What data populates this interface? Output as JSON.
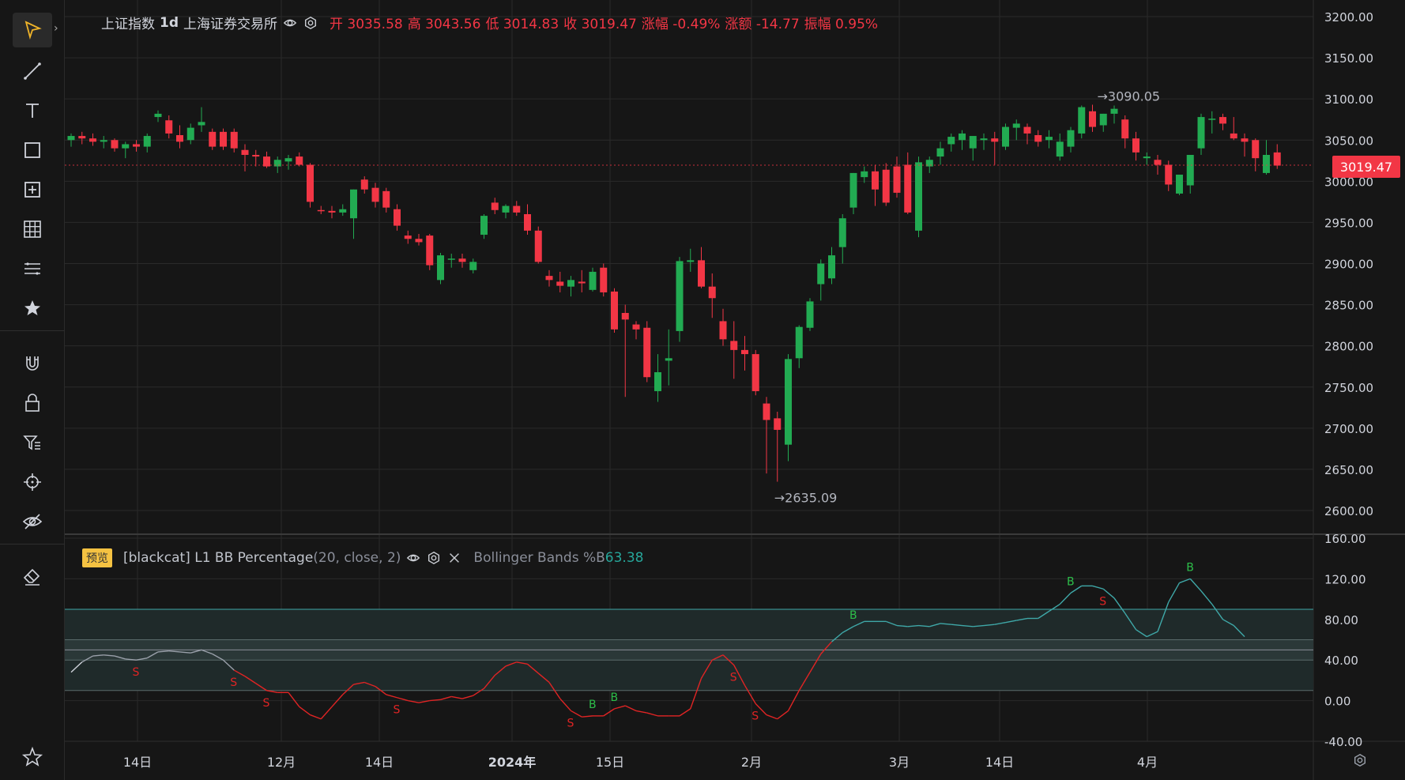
{
  "toolbar": {
    "tooltip": "光标",
    "tools": [
      {
        "name": "cursor-tool-icon",
        "active": true
      },
      {
        "name": "trend-line-tool-icon"
      },
      {
        "name": "text-tool-icon"
      },
      {
        "name": "rectangle-tool-icon"
      },
      {
        "name": "measure-tool-icon"
      },
      {
        "name": "grid-tool-icon"
      },
      {
        "name": "fib-tool-icon"
      },
      {
        "name": "favorite-star-icon"
      },
      {
        "name": "magnet-icon"
      },
      {
        "name": "lock-icon"
      },
      {
        "name": "filter-icon"
      },
      {
        "name": "crosshair-icon"
      },
      {
        "name": "hide-eye-icon"
      },
      {
        "name": "eraser-icon"
      },
      {
        "name": "star-outline-icon"
      }
    ]
  },
  "legend": {
    "symbol": "上证指数",
    "interval": "1d",
    "exchange": "上海证券交易所",
    "open_label": "开",
    "open": "3035.58",
    "high_label": "高",
    "high": "3043.56",
    "low_label": "低",
    "low": "3014.83",
    "close_label": "收",
    "close": "3019.47",
    "change_pct_label": "涨幅",
    "change_pct": "-0.49%",
    "change_label": "涨额",
    "change": "-14.77",
    "amplitude_label": "振幅",
    "amplitude": "0.95%"
  },
  "indicator": {
    "badge": "预览",
    "name": "[blackcat] L1 BB Percentage",
    "params": "(20, close, 2)",
    "series_label": "Bollinger Bands %B",
    "value": "63.38"
  },
  "colors": {
    "up": "#089981",
    "up_fill": "#22ab52",
    "down": "#f23645",
    "line_red": "#e02424",
    "line_teal": "#3fa8a8",
    "bg": "#161616",
    "grid": "#2a2a2a"
  },
  "chart_data": [
    {
      "type": "candlestick",
      "ylim": [
        2580,
        3220
      ],
      "y_ticks": [
        "3200.00",
        "3150.00",
        "3100.00",
        "3050.00",
        "3000.00",
        "2950.00",
        "2900.00",
        "2850.00",
        "2800.00",
        "2750.00",
        "2700.00",
        "2650.00",
        "2600.00"
      ],
      "x_ticks": [
        "14日",
        "12月",
        "14日",
        "2024年",
        "15日",
        "2月",
        "3月",
        "14日",
        "4月"
      ],
      "last_price_label": "3019.47",
      "annotations": [
        "→3090.05",
        "→2635.09"
      ],
      "ohlc": [
        [
          3050,
          3058,
          3042,
          3055
        ],
        [
          3055,
          3060,
          3045,
          3052
        ],
        [
          3052,
          3058,
          3043,
          3048
        ],
        [
          3048,
          3055,
          3040,
          3050
        ],
        [
          3050,
          3052,
          3036,
          3040
        ],
        [
          3040,
          3048,
          3028,
          3045
        ],
        [
          3045,
          3050,
          3036,
          3042
        ],
        [
          3042,
          3058,
          3035,
          3055
        ],
        [
          3078,
          3086,
          3072,
          3082
        ],
        [
          3074,
          3080,
          3052,
          3058
        ],
        [
          3056,
          3068,
          3040,
          3048
        ],
        [
          3050,
          3070,
          3045,
          3065
        ],
        [
          3068,
          3090,
          3060,
          3072
        ],
        [
          3060,
          3064,
          3038,
          3042
        ],
        [
          3060,
          3064,
          3038,
          3042
        ],
        [
          3060,
          3064,
          3035,
          3040
        ],
        [
          3038,
          3045,
          3012,
          3032
        ],
        [
          3032,
          3038,
          3018,
          3030
        ],
        [
          3030,
          3036,
          3016,
          3018
        ],
        [
          3018,
          3030,
          3010,
          3026
        ],
        [
          3024,
          3032,
          3014,
          3028
        ],
        [
          3030,
          3035,
          3018,
          3020
        ],
        [
          3020,
          3022,
          2968,
          2975
        ],
        [
          2965,
          2970,
          2960,
          2964
        ],
        [
          2964,
          2970,
          2955,
          2962
        ],
        [
          2962,
          2972,
          2958,
          2966
        ],
        [
          2955,
          2990,
          2930,
          2990
        ],
        [
          3002,
          3006,
          2985,
          2990
        ],
        [
          2992,
          2998,
          2968,
          2975
        ],
        [
          2988,
          2992,
          2962,
          2968
        ],
        [
          2966,
          2972,
          2940,
          2946
        ],
        [
          2934,
          2940,
          2924,
          2930
        ],
        [
          2930,
          2936,
          2922,
          2926
        ],
        [
          2934,
          2936,
          2892,
          2898
        ],
        [
          2880,
          2913,
          2875,
          2910
        ],
        [
          2905,
          2912,
          2895,
          2906
        ],
        [
          2906,
          2912,
          2895,
          2902
        ],
        [
          2892,
          2906,
          2888,
          2902
        ],
        [
          2935,
          2960,
          2930,
          2958
        ],
        [
          2974,
          2980,
          2960,
          2965
        ],
        [
          2962,
          2972,
          2955,
          2970
        ],
        [
          2970,
          2976,
          2958,
          2962
        ],
        [
          2960,
          2972,
          2935,
          2940
        ],
        [
          2940,
          2945,
          2900,
          2902
        ],
        [
          2885,
          2892,
          2872,
          2880
        ],
        [
          2878,
          2890,
          2865,
          2873
        ],
        [
          2872,
          2885,
          2860,
          2880
        ],
        [
          2878,
          2892,
          2865,
          2876
        ],
        [
          2868,
          2895,
          2866,
          2890
        ],
        [
          2895,
          2900,
          2860,
          2865
        ],
        [
          2866,
          2870,
          2816,
          2820
        ],
        [
          2840,
          2850,
          2738,
          2832
        ],
        [
          2826,
          2830,
          2808,
          2820
        ],
        [
          2822,
          2830,
          2756,
          2762
        ],
        [
          2745,
          2790,
          2732,
          2768
        ],
        [
          2782,
          2820,
          2752,
          2785
        ],
        [
          2818,
          2908,
          2805,
          2903
        ],
        [
          2902,
          2918,
          2890,
          2904
        ],
        [
          2904,
          2920,
          2870,
          2872
        ],
        [
          2872,
          2888,
          2834,
          2858
        ],
        [
          2830,
          2845,
          2800,
          2808
        ],
        [
          2806,
          2830,
          2760,
          2795
        ],
        [
          2795,
          2812,
          2770,
          2790
        ],
        [
          2790,
          2795,
          2740,
          2745
        ],
        [
          2730,
          2738,
          2645,
          2710
        ],
        [
          2712,
          2720,
          2635,
          2698
        ],
        [
          2680,
          2790,
          2660,
          2784
        ],
        [
          2785,
          2825,
          2773,
          2823
        ],
        [
          2822,
          2858,
          2818,
          2854
        ],
        [
          2875,
          2905,
          2855,
          2900
        ],
        [
          2882,
          2920,
          2875,
          2910
        ],
        [
          2920,
          2960,
          2900,
          2955
        ],
        [
          2968,
          3010,
          2960,
          3010
        ],
        [
          3005,
          3018,
          2998,
          3012
        ],
        [
          3012,
          3020,
          2970,
          2990
        ],
        [
          3014,
          3022,
          2970,
          2974
        ],
        [
          3018,
          3030,
          2980,
          2986
        ],
        [
          3020,
          3035,
          2960,
          2962
        ],
        [
          2940,
          3030,
          2932,
          3023
        ],
        [
          3018,
          3030,
          3010,
          3026
        ],
        [
          3030,
          3048,
          3020,
          3040
        ],
        [
          3045,
          3058,
          3036,
          3054
        ],
        [
          3050,
          3062,
          3038,
          3058
        ],
        [
          3040,
          3052,
          3025,
          3055
        ],
        [
          3050,
          3058,
          3038,
          3052
        ],
        [
          3052,
          3060,
          3020,
          3048
        ],
        [
          3042,
          3070,
          3038,
          3066
        ],
        [
          3065,
          3075,
          3050,
          3070
        ],
        [
          3066,
          3070,
          3045,
          3058
        ],
        [
          3056,
          3062,
          3042,
          3048
        ],
        [
          3050,
          3062,
          3040,
          3054
        ],
        [
          3030,
          3058,
          3025,
          3048
        ],
        [
          3042,
          3066,
          3035,
          3062
        ],
        [
          3058,
          3092,
          3052,
          3090
        ],
        [
          3085,
          3093,
          3060,
          3066
        ],
        [
          3068,
          3082,
          3060,
          3082
        ],
        [
          3082,
          3092,
          3070,
          3088
        ],
        [
          3075,
          3080,
          3040,
          3052
        ],
        [
          3052,
          3060,
          3025,
          3035
        ],
        [
          3028,
          3035,
          3020,
          3030
        ],
        [
          3026,
          3032,
          3008,
          3020
        ],
        [
          3020,
          3025,
          2988,
          2996
        ],
        [
          2985,
          3000,
          2983,
          3008
        ],
        [
          2995,
          3032,
          2985,
          3032
        ],
        [
          3040,
          3082,
          3032,
          3078
        ],
        [
          3075,
          3085,
          3058,
          3076
        ],
        [
          3078,
          3082,
          3062,
          3070
        ],
        [
          3058,
          3078,
          3050,
          3052
        ],
        [
          3052,
          3058,
          3030,
          3048
        ],
        [
          3050,
          3052,
          3012,
          3028
        ],
        [
          3010,
          3050,
          3008,
          3032
        ],
        [
          3035,
          3045,
          3015,
          3019
        ]
      ]
    },
    {
      "type": "line",
      "title": "[blackcat] L1 BB Percentage",
      "ylim": [
        -40,
        160
      ],
      "y_ticks": [
        "160.00",
        "120.00",
        "80.00",
        "40.00",
        "0.00",
        "-40.00"
      ],
      "band_levels": [
        90,
        60,
        50,
        40,
        10
      ],
      "signals": [
        {
          "label": "S",
          "i": 6
        },
        {
          "label": "S",
          "i": 15
        },
        {
          "label": "S",
          "i": 18
        },
        {
          "label": "S",
          "i": 30
        },
        {
          "label": "S",
          "i": 46
        },
        {
          "label": "B",
          "i": 48
        },
        {
          "label": "B",
          "i": 50
        },
        {
          "label": "S",
          "i": 61
        },
        {
          "label": "S",
          "i": 63
        },
        {
          "label": "B",
          "i": 72
        },
        {
          "label": "B",
          "i": 92
        },
        {
          "label": "S",
          "i": 95
        },
        {
          "label": "B",
          "i": 103
        }
      ],
      "values": [
        28,
        38,
        44,
        45,
        44,
        41,
        40,
        42,
        48,
        49,
        48,
        47,
        50,
        46,
        40,
        30,
        24,
        17,
        10,
        8,
        8,
        -6,
        -14,
        -18,
        -6,
        6,
        16,
        18,
        14,
        6,
        3,
        0,
        -2,
        0,
        1,
        4,
        2,
        5,
        12,
        25,
        34,
        38,
        36,
        27,
        18,
        2,
        -10,
        -16,
        -15,
        -15,
        -8,
        -5,
        -10,
        -12,
        -15,
        -15,
        -15,
        -8,
        22,
        40,
        45,
        35,
        15,
        -3,
        -14,
        -18,
        -10,
        10,
        28,
        46,
        58,
        67,
        73,
        78,
        78,
        78,
        74,
        73,
        74,
        73,
        76,
        75,
        74,
        73,
        74,
        75,
        77,
        79,
        81,
        81,
        88,
        95,
        106,
        113,
        113,
        110,
        101,
        86,
        70,
        63,
        68,
        97,
        116,
        120,
        108,
        95,
        80,
        74,
        63
      ]
    }
  ]
}
